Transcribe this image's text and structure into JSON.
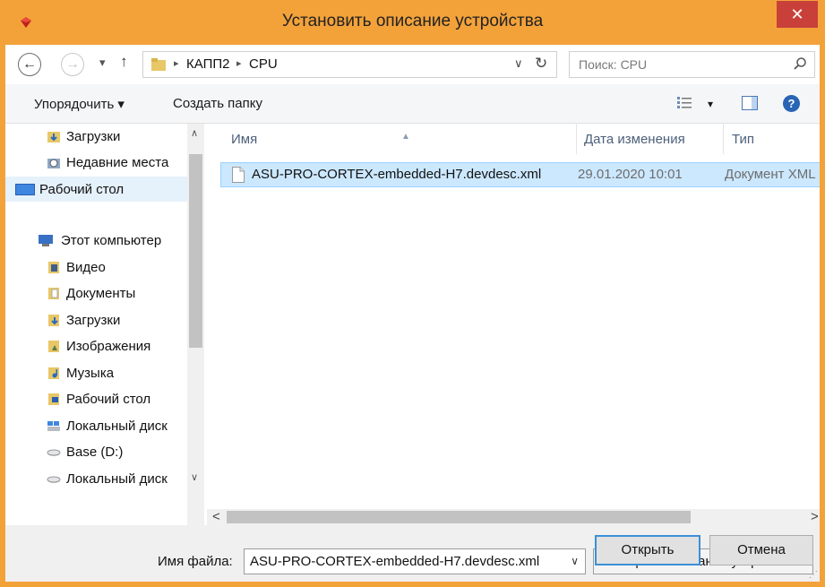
{
  "window": {
    "title": "Установить описание устройства",
    "close_glyph": "✕"
  },
  "address": {
    "back_glyph": "←",
    "forward_glyph": "→",
    "recent_glyph": "▾",
    "up_glyph": "↑",
    "crumbs": [
      "КАПП2",
      "CPU"
    ],
    "crumb_sep": "▸",
    "dropdown_glyph": "∨",
    "refresh_glyph": "↻",
    "search_placeholder": "Поиск: CPU"
  },
  "toolbar": {
    "organize_label": "Упорядочить ▾",
    "new_folder_label": "Создать папку",
    "view_glyph": "▾",
    "help_glyph": "?"
  },
  "navpane": {
    "items": [
      {
        "label": "Загрузки",
        "icon": "downloads-icon"
      },
      {
        "label": "Недавние места",
        "icon": "recent-places-icon"
      },
      {
        "label": "Рабочий стол",
        "icon": "desktop-icon"
      },
      {
        "label": "Этот компьютер",
        "icon": "computer-icon"
      },
      {
        "label": "Видео",
        "icon": "video-folder-icon"
      },
      {
        "label": "Документы",
        "icon": "documents-folder-icon"
      },
      {
        "label": "Загрузки",
        "icon": "downloads-folder-icon"
      },
      {
        "label": "Изображения",
        "icon": "pictures-folder-icon"
      },
      {
        "label": "Музыка",
        "icon": "music-folder-icon"
      },
      {
        "label": "Рабочий стол",
        "icon": "desktop-folder-icon"
      },
      {
        "label": "Локальный диск",
        "icon": "local-disk-icon"
      },
      {
        "label": "Base (D:)",
        "icon": "drive-icon"
      },
      {
        "label": "Локальный диск",
        "icon": "drive-icon"
      }
    ],
    "scroll_up": "∧",
    "scroll_down": "∨"
  },
  "filelist": {
    "columns": [
      "Имя",
      "Дата изменения",
      "Тип"
    ],
    "sort_glyph": "▲",
    "rows": [
      {
        "name": "ASU-PRO-CORTEX-embedded-H7.devdesc.xml",
        "date": "29.01.2020 10:01",
        "type": "Документ XML"
      }
    ],
    "scroll_left": "<",
    "scroll_right": ">"
  },
  "bottom": {
    "filename_label": "Имя файла:",
    "filename_value": "ASU-PRO-CORTEX-embedded-H7.devdesc.xml",
    "dropdown_glyph": "∨",
    "filetype_value": "XML-файл описания устройства",
    "open_label": "Открыть",
    "cancel_label": "Отмена",
    "grip_glyph": "⋰"
  },
  "colors": {
    "title_bar": "#f3a23a",
    "close_button": "#c9403a",
    "selection": "#cce8ff",
    "selection_border": "#99d1ff",
    "default_button_border": "#3c8fd6"
  }
}
